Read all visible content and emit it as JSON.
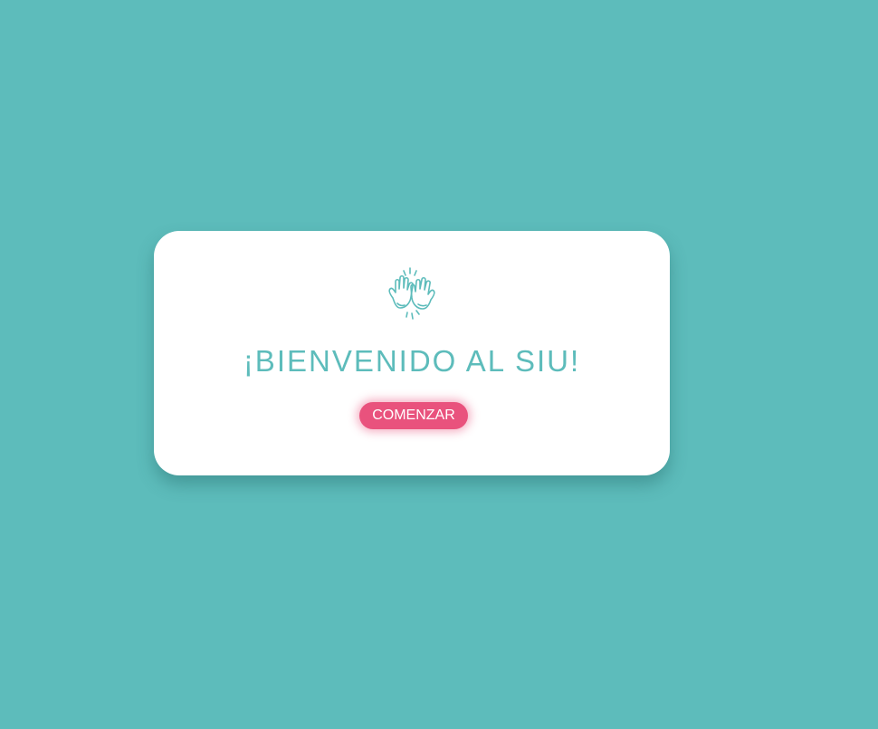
{
  "welcome_card": {
    "icon": "high-five-icon",
    "title": "¡BIENVENIDO AL SIU!",
    "start_button_label": "COMENZAR"
  },
  "colors": {
    "background": "#5dbcbb",
    "card": "#ffffff",
    "title": "#5dbcbb",
    "button": "#e9527d",
    "button_text": "#ffffff"
  }
}
